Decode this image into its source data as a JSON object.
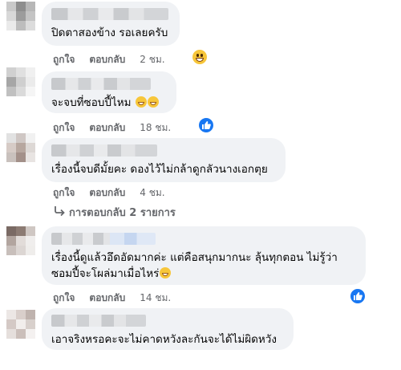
{
  "comments": [
    {
      "text_lines": [
        "ปิดตาสองข้าง รอเลยครับ"
      ],
      "emojis": 0,
      "like": "ถูกใจ",
      "reply": "ตอบกลับ",
      "time": "2 ชม.",
      "reaction": "grin-emoji"
    },
    {
      "text_lines": [
        "จะจบที่ซอบปี้ไหม"
      ],
      "emojis": 2,
      "like": "ถูกใจ",
      "reply": "ตอบกลับ",
      "time": "18 ชม.",
      "reaction": "like-icon"
    },
    {
      "text_lines": [
        "เรื่องนี้จบดีมั้ยคะ ดองไว้ไม่กล้าดูกลัวนางเอกตุย"
      ],
      "emojis": 0,
      "like": "ถูกใจ",
      "reply": "ตอบกลับ",
      "time": "4 ชม.",
      "reaction": ""
    },
    {
      "text_lines": [
        "เรื่องนี้ดูแล้วอึดอัดมากค่ะ แต่คือสนุกมากนะ ลุ้นทุกตอน ไม่รู้ว่า",
        "ซอมปี้จะโผล่มาเมื่อไหร่"
      ],
      "emojis": 1,
      "like": "ถูกใจ",
      "reply": "ตอบกลับ",
      "time": "14 ชม.",
      "reaction": "like-icon"
    },
    {
      "text_lines": [
        "เอาจริงหรอคะจะไม่คาดหวังละกันจะได้ไม่ผิดหวัง"
      ],
      "emojis": 0,
      "like": "",
      "reply": "",
      "time": "",
      "reaction": ""
    }
  ],
  "replies_link": "การตอบกลับ 2 รายการ",
  "colors": {
    "bubble": "#f0f2f5",
    "meta": "#65676b",
    "like_blue": "#1877f2"
  }
}
